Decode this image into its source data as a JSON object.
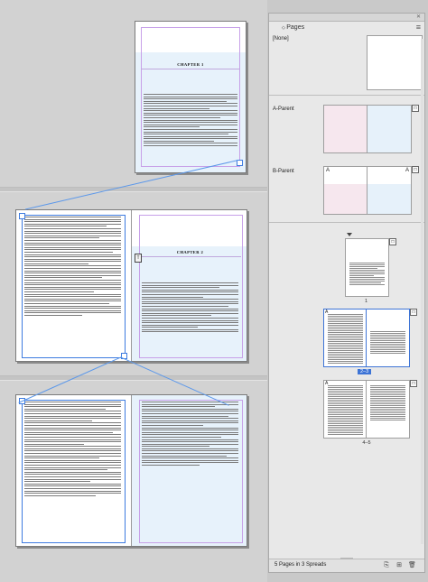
{
  "panel": {
    "title": "Pages",
    "none_label": "[None]",
    "a_parent_label": "A-Parent",
    "b_parent_label": "B-Parent",
    "b_left_letter": "A",
    "b_right_letter": "A",
    "page_1_label": "1",
    "spread_2_3_label": "2–3",
    "spread_4_5_label": "4–5",
    "footer_text": "5 Pages in 3 Spreads",
    "menu_icon": "panel-menu-icon"
  },
  "document": {
    "chapter_1_heading": "CHAPTER 1",
    "chapter_2_heading": "CHAPTER 2"
  },
  "colors": {
    "selection_blue": "#3d74d6",
    "text_frame_blue": "#3d7be0",
    "parent_pink": "#f6e7ee",
    "parent_blue": "#e6f1fa"
  }
}
